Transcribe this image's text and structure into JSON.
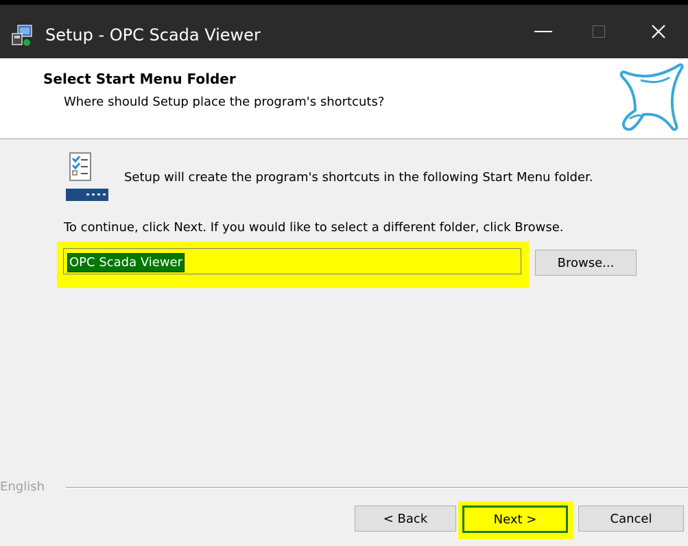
{
  "window": {
    "title": "Setup - OPC Scada Viewer"
  },
  "header": {
    "title": "Select Start Menu Folder",
    "subtitle": "Where should Setup place the program's shortcuts?"
  },
  "body": {
    "info": "Setup will create the program's shortcuts in the following Start Menu folder.",
    "instruction": "To continue, click Next. If you would like to select a different folder, click Browse.",
    "folder_value": "OPC Scada Viewer",
    "browse_label": "Browse..."
  },
  "footer": {
    "language": "English",
    "back_label": "< Back",
    "next_label": "Next >",
    "cancel_label": "Cancel"
  },
  "icons": {
    "app": "installer-icon",
    "logo": "propeller-logo-icon",
    "folder": "start-menu-folder-icon",
    "minimize": "minimize-icon",
    "maximize": "maximize-icon",
    "close": "close-icon"
  },
  "colors": {
    "highlight": "#ffff00",
    "selection": "#007800",
    "logo": "#3aa8d8",
    "titlebar": "#2b2b2b"
  }
}
